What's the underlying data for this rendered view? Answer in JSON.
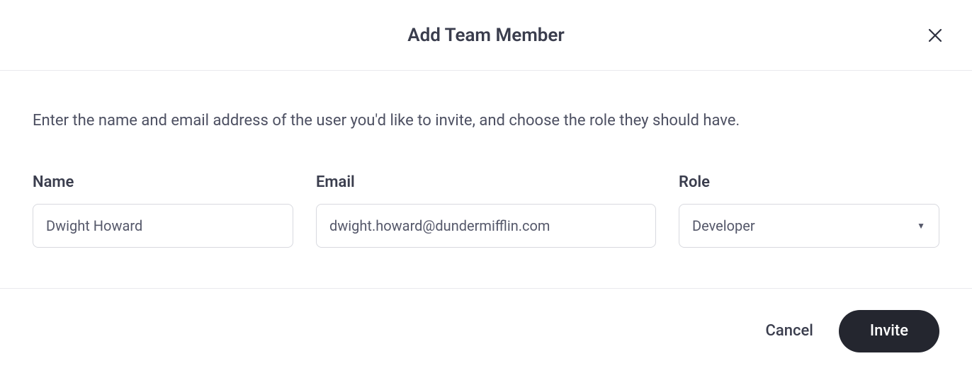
{
  "dialog": {
    "title": "Add Team Member",
    "instruction": "Enter the name and email address of the user you'd like to invite, and choose the role they should have."
  },
  "form": {
    "name": {
      "label": "Name",
      "value": "Dwight Howard"
    },
    "email": {
      "label": "Email",
      "value": "dwight.howard@dundermifflin.com"
    },
    "role": {
      "label": "Role",
      "selected": "Developer"
    }
  },
  "actions": {
    "cancel": "Cancel",
    "invite": "Invite"
  }
}
